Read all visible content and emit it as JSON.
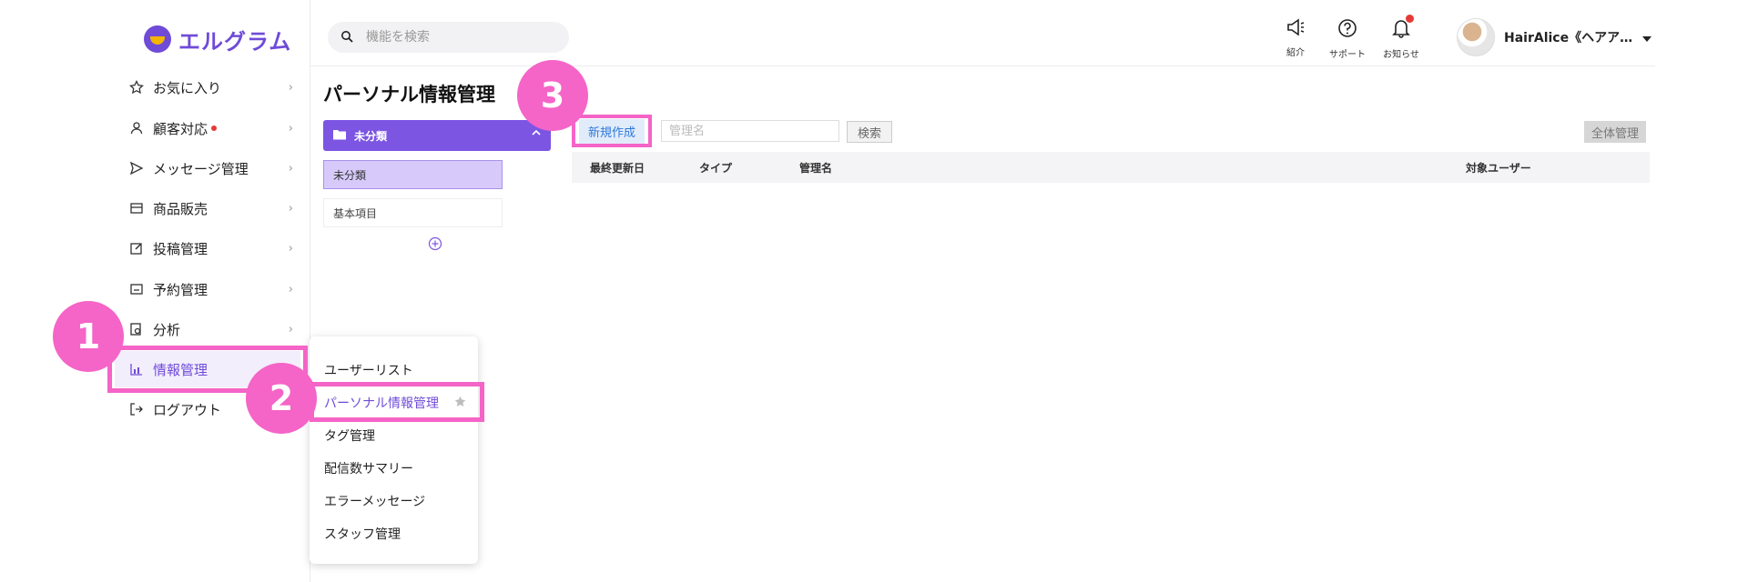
{
  "app": {
    "logo_text": "エルグラム",
    "brand_color": "#6f4bd8",
    "accent_pink": "#f564c7"
  },
  "sidebar": {
    "items": [
      {
        "label": "お気に入り",
        "icon": "star-icon"
      },
      {
        "label": "顧客対応",
        "icon": "person-icon",
        "has_alert_dot": true
      },
      {
        "label": "メッセージ管理",
        "icon": "send-icon"
      },
      {
        "label": "商品販売",
        "icon": "shop-icon"
      },
      {
        "label": "投稿管理",
        "icon": "edit-icon"
      },
      {
        "label": "予約管理",
        "icon": "calendar-icon"
      },
      {
        "label": "分析",
        "icon": "analysis-icon"
      },
      {
        "label": "情報管理",
        "icon": "chart-icon",
        "active": true
      },
      {
        "label": "ログアウト",
        "icon": "logout-icon"
      }
    ]
  },
  "search": {
    "placeholder": "機能を検索"
  },
  "topbar": {
    "intro_label": "紹介",
    "support_label": "サポート",
    "notice_label": "お知らせ",
    "user_name": "HairAlice《ヘアア…"
  },
  "main": {
    "title": "パーソナル情報管理",
    "category_header": "未分類",
    "categories": [
      "未分類",
      "基本項目"
    ],
    "new_button": "新規作成",
    "name_placeholder": "管理名",
    "search_button": "検索",
    "manage_all_button": "全体管理",
    "columns": [
      "最終更新日",
      "タイプ",
      "管理名",
      "対象ユーザー"
    ]
  },
  "submenu": {
    "items": [
      "ユーザーリスト",
      "パーソナル情報管理",
      "タグ管理",
      "配信数サマリー",
      "エラーメッセージ",
      "スタッフ管理"
    ]
  },
  "annotations": {
    "badges": [
      "1",
      "2",
      "3"
    ]
  }
}
